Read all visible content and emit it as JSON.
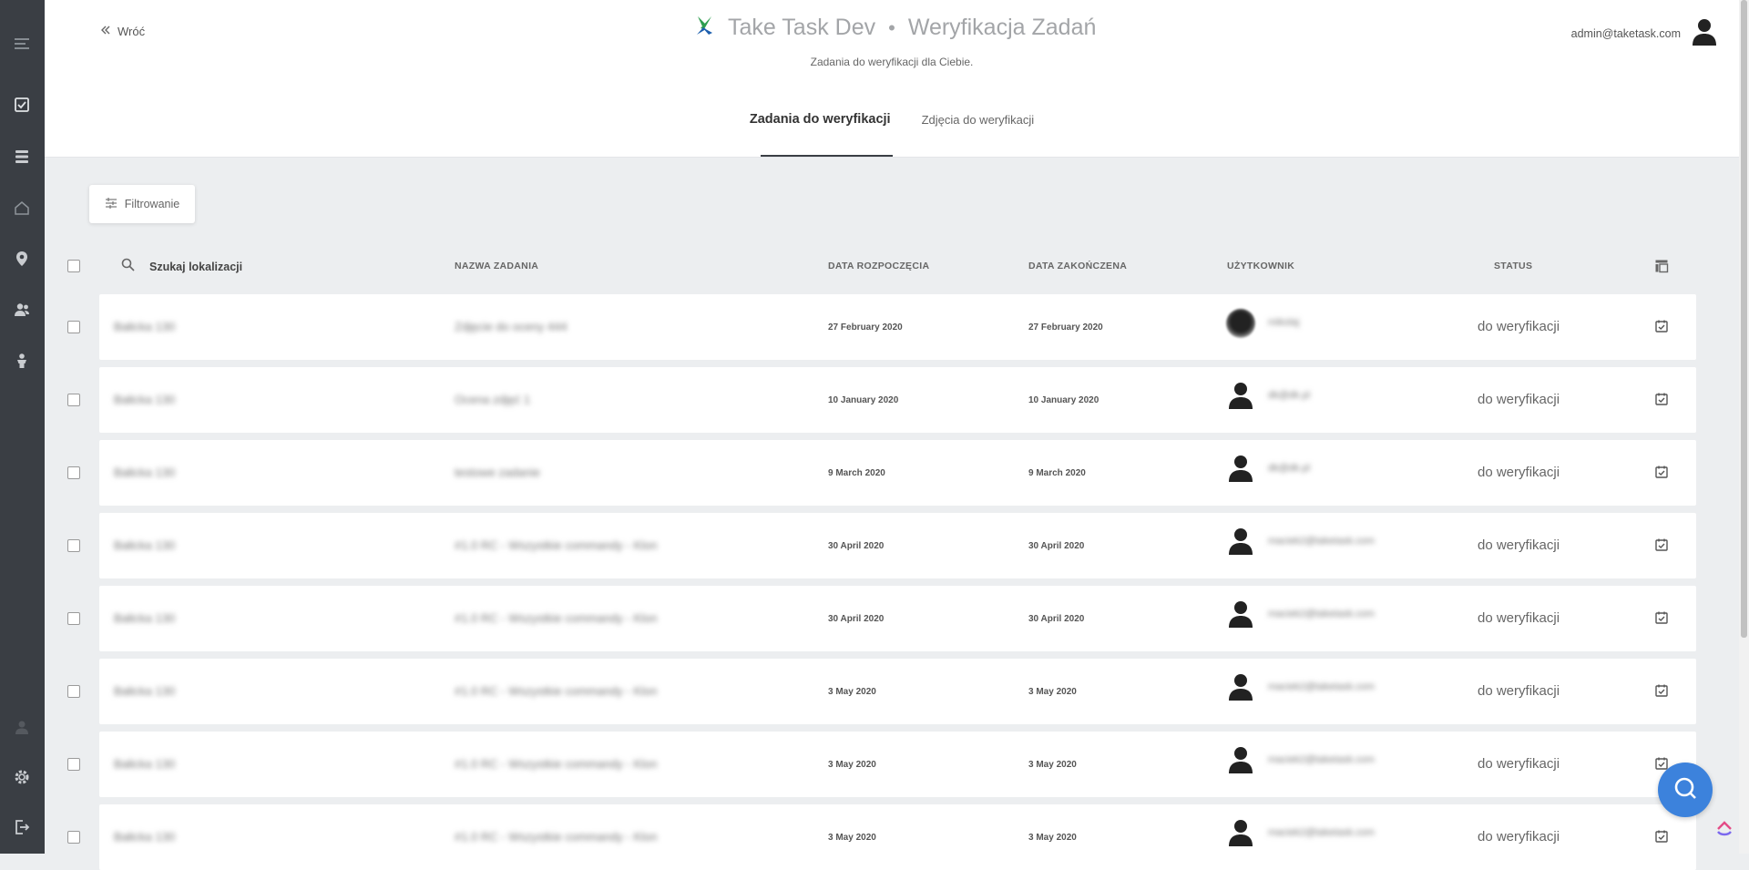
{
  "sidebar": {
    "icons": [
      "menu-icon",
      "tasks-check-icon",
      "layers-icon",
      "home-icon",
      "location-pin-icon",
      "users-icon",
      "person-icon",
      "user-icon",
      "settings-icon",
      "logout-icon"
    ]
  },
  "header": {
    "back_label": "Wróć",
    "app_name": "Take Task Dev",
    "separator": "•",
    "page_title": "Weryfikacja Zadań",
    "subtitle": "Zadania do weryfikacji dla Ciebie.",
    "user_email": "admin@taketask.com"
  },
  "tabs": [
    {
      "label": "Zadania do weryfikacji",
      "active": true
    },
    {
      "label": "Zdjęcia do weryfikacji",
      "active": false
    }
  ],
  "filter": {
    "label": "Filtrowanie"
  },
  "table": {
    "search_placeholder": "Szukaj lokalizacji",
    "columns": {
      "task_name": "NAZWA ZADANIA",
      "start_date": "DATA ROZPOCZĘCIA",
      "end_date": "DATA ZAKOŃCZENA",
      "user": "UŻYTKOWNIK",
      "status": "STATUS"
    },
    "rows": [
      {
        "location": "Bałicka 130",
        "task": "Zdjęcie do oceny 444",
        "start": "27 February 2020",
        "end": "27 February 2020",
        "user": "mikolaj",
        "avatar": "photo",
        "status": "do weryfikacji"
      },
      {
        "location": "Bałicka 130",
        "task": "Ocena zdjęć 1",
        "start": "10 January 2020",
        "end": "10 January 2020",
        "user": "dk@dk.pl",
        "avatar": "silhouette",
        "status": "do weryfikacji"
      },
      {
        "location": "Bałicka 130",
        "task": "testowe zadanie",
        "start": "9 March 2020",
        "end": "9 March 2020",
        "user": "dk@dk.pl",
        "avatar": "silhouette",
        "status": "do weryfikacji"
      },
      {
        "location": "Bałicka 130",
        "task": "#1.0 RC - Wszystkie commandy - Klon",
        "start": "30 April 2020",
        "end": "30 April 2020",
        "user": "maciek2@taketask.com",
        "avatar": "silhouette",
        "status": "do weryfikacji"
      },
      {
        "location": "Bałicka 130",
        "task": "#1.0 RC - Wszystkie commandy - Klon",
        "start": "30 April 2020",
        "end": "30 April 2020",
        "user": "maciek2@taketask.com",
        "avatar": "silhouette",
        "status": "do weryfikacji"
      },
      {
        "location": "Bałicka 130",
        "task": "#1.0 RC - Wszystkie commandy - Klon",
        "start": "3 May 2020",
        "end": "3 May 2020",
        "user": "maciek2@taketask.com",
        "avatar": "silhouette",
        "status": "do weryfikacji"
      },
      {
        "location": "Bałicka 130",
        "task": "#1.0 RC - Wszystkie commandy - Klon",
        "start": "3 May 2020",
        "end": "3 May 2020",
        "user": "maciek2@taketask.com",
        "avatar": "silhouette",
        "status": "do weryfikacji"
      },
      {
        "location": "Bałicka 130",
        "task": "#1.0 RC - Wszystkie commandy - Klon",
        "start": "3 May 2020",
        "end": "3 May 2020",
        "user": "maciek2@taketask.com",
        "avatar": "silhouette",
        "status": "do weryfikacji"
      }
    ]
  },
  "colors": {
    "sidebar_bg": "#3a3e44",
    "page_bg": "#eceef0",
    "fab_bg": "#3c82dc",
    "logo_green": "#2e9e4f",
    "logo_blue": "#1d5fae"
  }
}
